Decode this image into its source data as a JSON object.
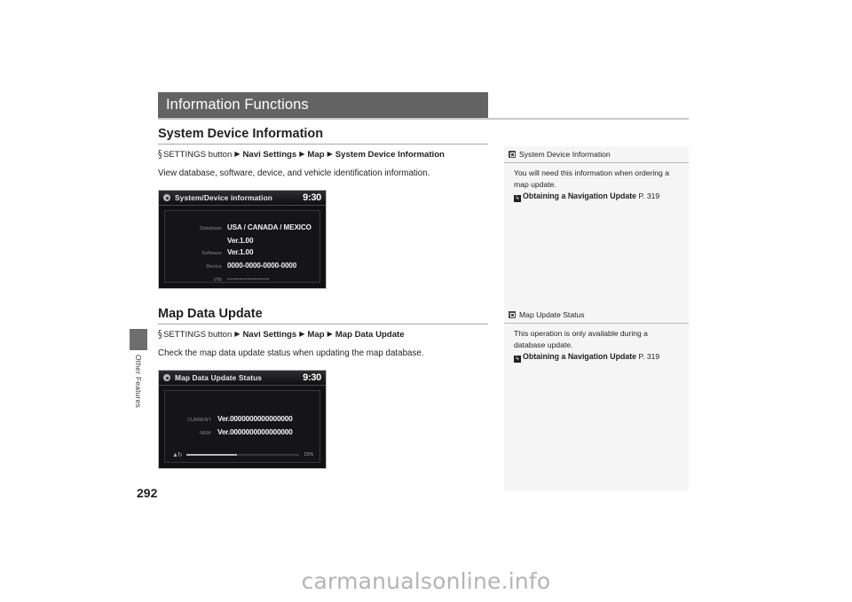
{
  "document": {
    "page_title": "Information Functions",
    "page_number": "292",
    "side_tab_label": "Other Features",
    "watermark": "carmanualsonline.info"
  },
  "sections": [
    {
      "heading": "System Device Information",
      "breadcrumb": {
        "button_glyph": "§",
        "button_label": "SETTINGS button",
        "arrow": "▶",
        "steps": [
          "Navi Settings",
          "Map",
          "System Device Information"
        ]
      },
      "description": "View database, software, device, and vehicle identification information.",
      "screen": {
        "title": "System/Device information",
        "clock": "9:30",
        "rows": [
          {
            "label": "Database",
            "value": "USA / CANADA / MEXICO"
          },
          {
            "label": "",
            "value": "Ver.1.00"
          },
          {
            "label": "Software",
            "value": "Ver.1.00"
          },
          {
            "label": "Device",
            "value": "0000-0000-0000-0000"
          },
          {
            "label": "VIN",
            "value": "-----------------"
          }
        ]
      }
    },
    {
      "heading": "Map Data Update",
      "breadcrumb": {
        "button_glyph": "§",
        "button_label": "SETTINGS button",
        "arrow": "▶",
        "steps": [
          "Navi Settings",
          "Map",
          "Map Data Update"
        ]
      },
      "description": "Check the map data update status when updating the map database.",
      "screen": {
        "title": "Map Data Update Status",
        "clock": "9:30",
        "rows": [
          {
            "label": "CURRENT",
            "value": "Ver.0000000000000000"
          },
          {
            "label": "NEW",
            "value": "Ver.0000000000000000"
          }
        ],
        "progress": {
          "icon": "▲↻",
          "percent_label": "15%",
          "fill_percent": 45
        }
      }
    }
  ],
  "sidebar": {
    "notes": [
      {
        "title": "System Device Information",
        "body": "You will need this information when ordering a map update.",
        "reference": {
          "icon": "↳",
          "title": "Obtaining a Navigation Update",
          "page": "P. 319"
        }
      },
      {
        "title": "Map Update Status",
        "body": "This operation is only available during a database update.",
        "reference": {
          "icon": "↳",
          "title": "Obtaining a Navigation Update",
          "page": "P. 319"
        }
      }
    ]
  },
  "colors": {
    "title_band": "#636363",
    "sidebar_bg": "#f5f5f5",
    "screen_bg": "#111113",
    "text": "#231f20"
  }
}
